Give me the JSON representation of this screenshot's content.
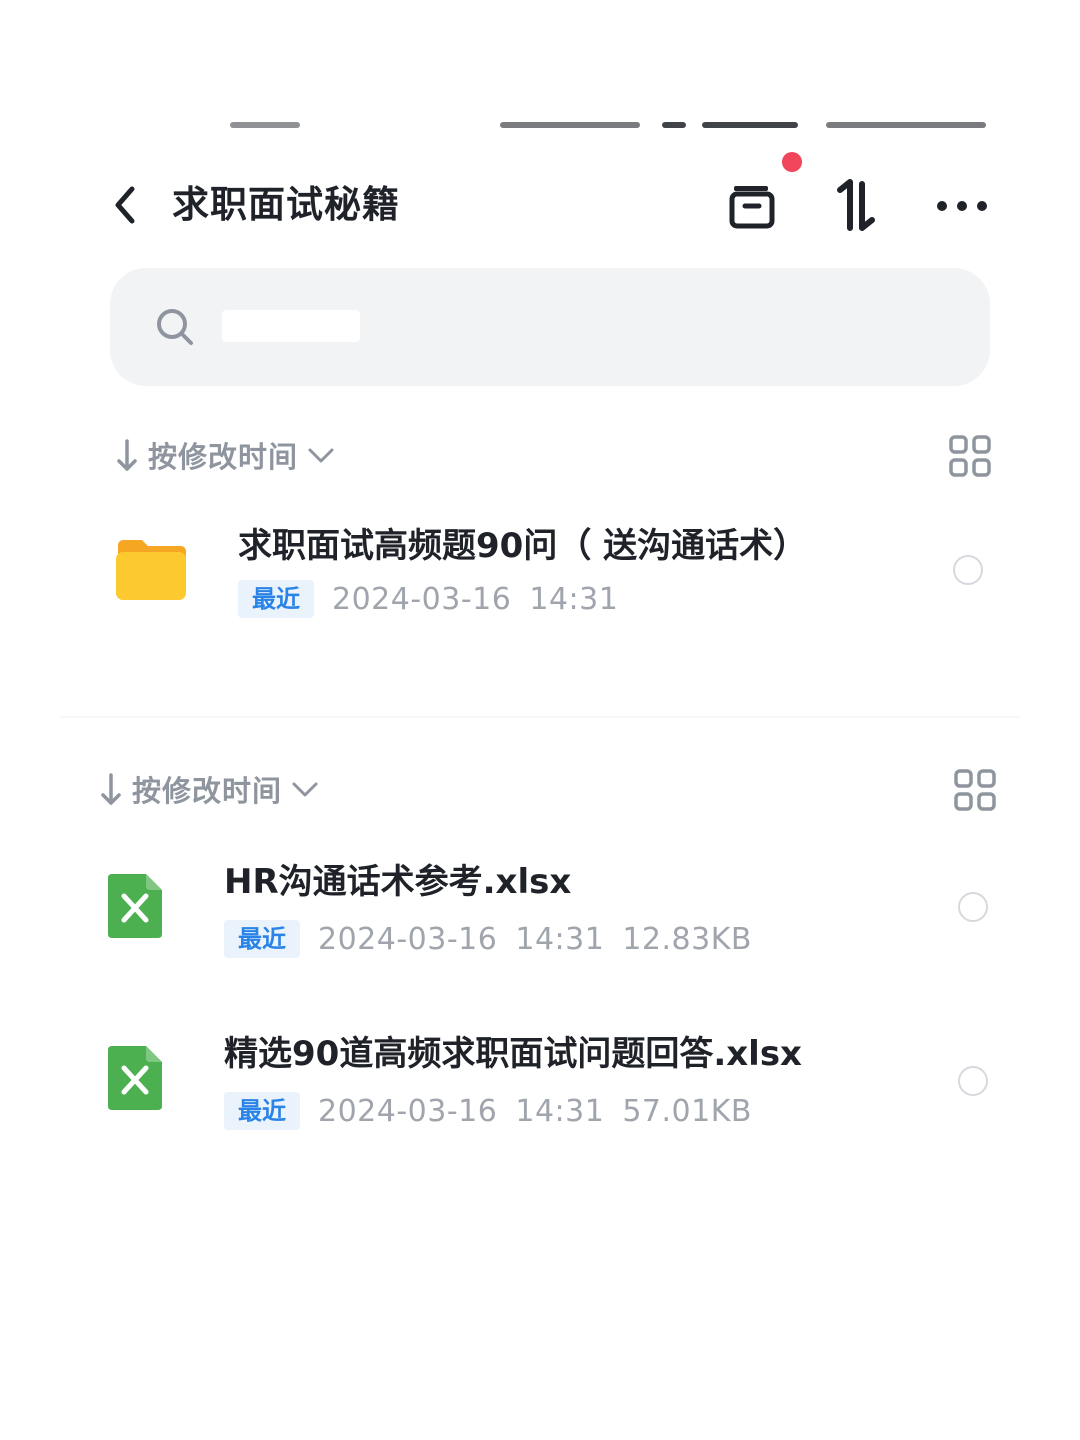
{
  "header": {
    "title": "求职面试秘籍",
    "back_icon": "chevron-left-icon",
    "actions": [
      "inbox-icon",
      "sort-icon",
      "more-icon"
    ],
    "notification_dot_color": "#f0455a"
  },
  "search": {
    "placeholder": "",
    "icon": "search-icon"
  },
  "sections": [
    {
      "sort_label": "按修改时间",
      "items": [
        {
          "type": "folder",
          "name": "求职面试高频题90问（ 送沟通话术）",
          "badge": "最近",
          "date": "2024-03-16",
          "time": "14:31"
        }
      ]
    },
    {
      "sort_label": "按修改时间",
      "items": [
        {
          "type": "xlsx",
          "name": "HR沟通话术参考.xlsx",
          "badge": "最近",
          "date": "2024-03-16",
          "time": "14:31",
          "size": "12.83KB"
        },
        {
          "type": "xlsx",
          "name": "精选90道高频求职面试问题回答.xlsx",
          "badge": "最近",
          "date": "2024-03-16",
          "time": "14:31",
          "size": "57.01KB"
        }
      ]
    }
  ],
  "colors": {
    "accent_blue": "#2a83e6",
    "badge_bg": "#eaf3fc",
    "folder_yellow": "#fcc92e",
    "excel_green": "#4caf50",
    "muted_text": "#a0a5ad"
  }
}
